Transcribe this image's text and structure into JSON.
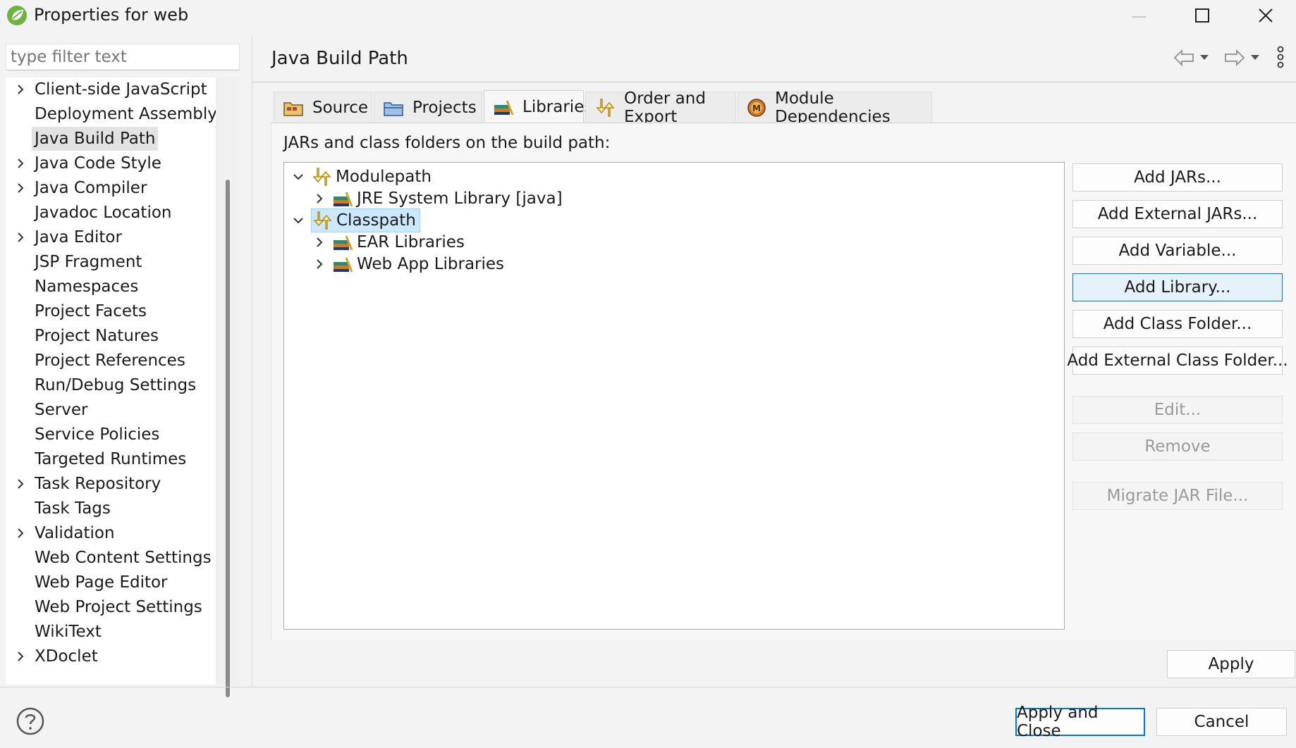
{
  "window": {
    "title": "Properties for web",
    "controls": {
      "minimize": "minimize-icon",
      "maximize": "maximize-icon",
      "close": "close-icon"
    }
  },
  "sidebar": {
    "filter_placeholder": "type filter text",
    "items": [
      {
        "label": "Client-side JavaScript",
        "expandable": true
      },
      {
        "label": "Deployment Assembly",
        "expandable": false
      },
      {
        "label": "Java Build Path",
        "expandable": false,
        "selected": true
      },
      {
        "label": "Java Code Style",
        "expandable": true
      },
      {
        "label": "Java Compiler",
        "expandable": true
      },
      {
        "label": "Javadoc Location",
        "expandable": false
      },
      {
        "label": "Java Editor",
        "expandable": true
      },
      {
        "label": "JSP Fragment",
        "expandable": false
      },
      {
        "label": "Namespaces",
        "expandable": false
      },
      {
        "label": "Project Facets",
        "expandable": false
      },
      {
        "label": "Project Natures",
        "expandable": false
      },
      {
        "label": "Project References",
        "expandable": false
      },
      {
        "label": "Run/Debug Settings",
        "expandable": false
      },
      {
        "label": "Server",
        "expandable": false
      },
      {
        "label": "Service Policies",
        "expandable": false
      },
      {
        "label": "Targeted Runtimes",
        "expandable": false
      },
      {
        "label": "Task Repository",
        "expandable": true
      },
      {
        "label": "Task Tags",
        "expandable": false
      },
      {
        "label": "Validation",
        "expandable": true
      },
      {
        "label": "Web Content Settings",
        "expandable": false
      },
      {
        "label": "Web Page Editor",
        "expandable": false
      },
      {
        "label": "Web Project Settings",
        "expandable": false
      },
      {
        "label": "WikiText",
        "expandable": false
      },
      {
        "label": "XDoclet",
        "expandable": true
      }
    ]
  },
  "page": {
    "title": "Java Build Path",
    "tabs": [
      {
        "label": "Source",
        "icon": "source-folder-icon"
      },
      {
        "label": "Projects",
        "icon": "projects-folder-icon"
      },
      {
        "label": "Libraries",
        "icon": "libraries-icon",
        "active": true
      },
      {
        "label": "Order and Export",
        "icon": "order-export-icon"
      },
      {
        "label": "Module Dependencies",
        "icon": "module-icon"
      }
    ],
    "build_path_label": "JARs and class folders on the build path:",
    "tree": {
      "modulepath": "Modulepath",
      "jre": "JRE System Library [java]",
      "classpath": "Classpath",
      "ear": "EAR Libraries",
      "webapp": "Web App Libraries"
    },
    "buttons": {
      "add_jars": "Add JARs...",
      "add_external_jars": "Add External JARs...",
      "add_variable": "Add Variable...",
      "add_library": "Add Library...",
      "add_class_folder": "Add Class Folder...",
      "add_external_class_folder": "Add External Class Folder...",
      "edit": "Edit...",
      "remove": "Remove",
      "migrate_jar": "Migrate JAR File..."
    },
    "apply": "Apply"
  },
  "footer": {
    "apply_and_close": "Apply and Close",
    "cancel": "Cancel"
  },
  "colors": {
    "accent": "#0078d7",
    "selection": "#cce8ff"
  }
}
